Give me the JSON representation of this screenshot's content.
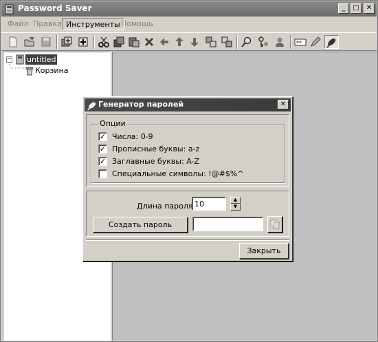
{
  "window": {
    "title": "Password Saver",
    "controls": [
      "_",
      "□",
      "✕"
    ]
  },
  "menu": {
    "items": [
      "Файл",
      "Правка",
      "Инструменты",
      "Помощь"
    ],
    "active_index": 2
  },
  "toolbar": {
    "icons": [
      "new-icon",
      "open-icon",
      "save-icon",
      "add-folder-icon",
      "add-item-icon",
      "cut-icon",
      "copy-icon",
      "paste-icon",
      "delete-icon",
      "arrow-left-icon",
      "arrow-up-icon",
      "arrow-down-icon",
      "sort-az-icon",
      "sort-za-icon",
      "find-icon",
      "key-icon",
      "user-icon",
      "password-field-icon",
      "pencil-icon",
      "generator-icon"
    ]
  },
  "tree": {
    "root": {
      "label": "untitled",
      "toggle": "−"
    },
    "children": [
      {
        "label": "Корзина"
      }
    ]
  },
  "dialog": {
    "title": "Генератор паролей",
    "close": "✕",
    "options_legend": "Опции",
    "options": [
      {
        "label": "Числа: 0-9",
        "checked": true
      },
      {
        "label": "Прописные буквы: a-z",
        "checked": true
      },
      {
        "label": "Заглавные буквы: A-Z",
        "checked": true
      },
      {
        "label": "Специальные символы: !@#$%^",
        "checked": false
      }
    ],
    "length_label": "Длина пароля:",
    "length_value": "10",
    "generate_label": "Создать пароль",
    "result_value": "",
    "close_label": "Закрыть"
  }
}
